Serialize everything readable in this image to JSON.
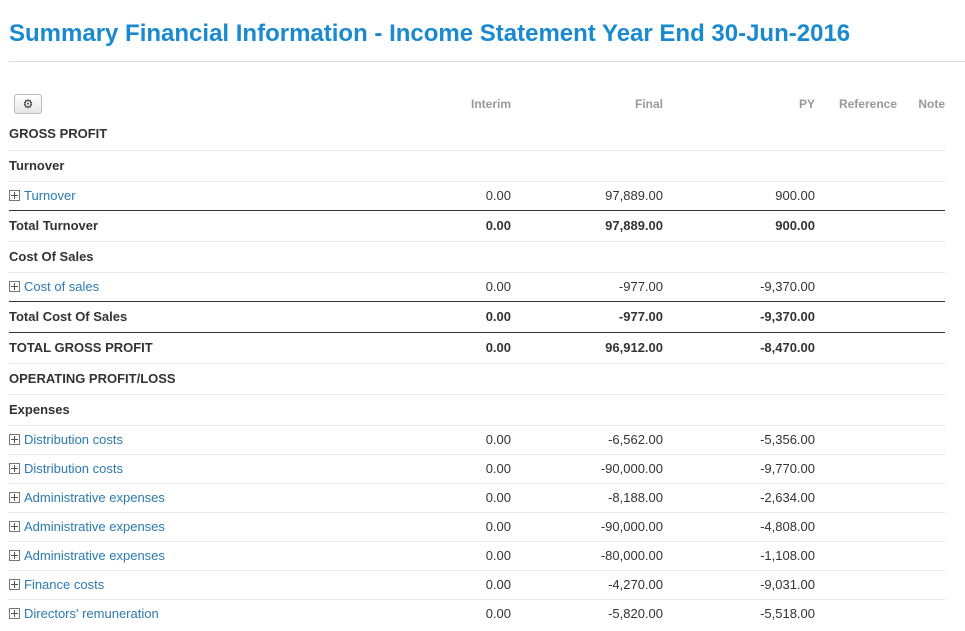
{
  "page_title": "Summary Financial Information - Income Statement Year End 30-Jun-2016",
  "settings_icon": "gear-icon",
  "columns": {
    "interim": "Interim",
    "final": "Final",
    "py": "PY",
    "reference": "Reference",
    "note": "Note"
  },
  "colors": {
    "title": "#1a8ad0",
    "link": "#2a7ab0"
  },
  "rows": [
    {
      "kind": "section",
      "label": "GROSS PROFIT"
    },
    {
      "kind": "subsection",
      "label": "Turnover"
    },
    {
      "kind": "account",
      "label": "Turnover",
      "interim": "0.00",
      "final": "97,889.00",
      "py": "900.00"
    },
    {
      "kind": "subtotal",
      "label": "Total Turnover",
      "interim": "0.00",
      "final": "97,889.00",
      "py": "900.00"
    },
    {
      "kind": "subsection",
      "label": "Cost Of Sales"
    },
    {
      "kind": "account",
      "label": "Cost of sales",
      "interim": "0.00",
      "final": "-977.00",
      "py": "-9,370.00"
    },
    {
      "kind": "subtotal",
      "label": "Total Cost Of Sales",
      "interim": "0.00",
      "final": "-977.00",
      "py": "-9,370.00"
    },
    {
      "kind": "grandtotal",
      "label": "TOTAL GROSS PROFIT",
      "interim": "0.00",
      "final": "96,912.00",
      "py": "-8,470.00"
    },
    {
      "kind": "section",
      "label": "OPERATING PROFIT/LOSS"
    },
    {
      "kind": "subsection",
      "label": "Expenses"
    },
    {
      "kind": "account",
      "label": "Distribution costs",
      "interim": "0.00",
      "final": "-6,562.00",
      "py": "-5,356.00"
    },
    {
      "kind": "account",
      "label": "Distribution costs",
      "interim": "0.00",
      "final": "-90,000.00",
      "py": "-9,770.00"
    },
    {
      "kind": "account",
      "label": "Administrative expenses",
      "interim": "0.00",
      "final": "-8,188.00",
      "py": "-2,634.00"
    },
    {
      "kind": "account",
      "label": "Administrative expenses",
      "interim": "0.00",
      "final": "-90,000.00",
      "py": "-4,808.00"
    },
    {
      "kind": "account",
      "label": "Administrative expenses",
      "interim": "0.00",
      "final": "-80,000.00",
      "py": "-1,108.00"
    },
    {
      "kind": "account",
      "label": "Finance costs",
      "interim": "0.00",
      "final": "-4,270.00",
      "py": "-9,031.00"
    },
    {
      "kind": "account",
      "label": "Directors' remuneration",
      "interim": "0.00",
      "final": "-5,820.00",
      "py": "-5,518.00"
    }
  ]
}
